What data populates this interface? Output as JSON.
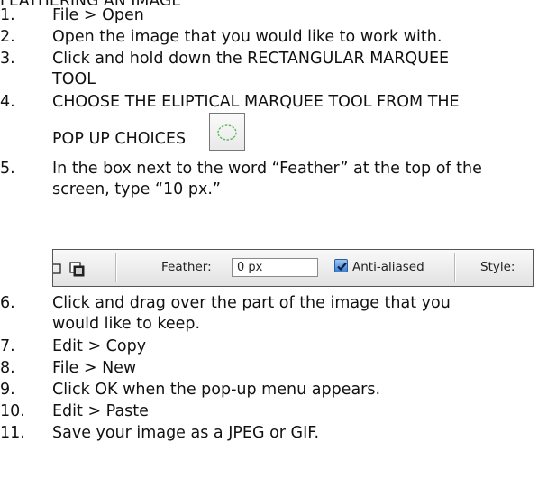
{
  "header": "FEATHERING AN IMAGE",
  "steps": [
    {
      "num": "1.",
      "lines": [
        "File > Open"
      ]
    },
    {
      "num": "2.",
      "lines": [
        "Open the image that you would like to work with."
      ]
    },
    {
      "num": "3.",
      "lines": [
        "Click and hold down the RECTANGULAR MARQUEE",
        "TOOL"
      ]
    },
    {
      "num": "4.",
      "lines": [
        "CHOOSE THE ELIPTICAL MARQUEE TOOL FROM THE",
        "POP UP CHOICES"
      ]
    },
    {
      "num": "5.",
      "lines": [
        "In the box next to the word “Feather” at the top of the",
        "screen, type “10 px.”"
      ]
    },
    {
      "num": "6.",
      "lines": [
        "Click and drag over the part of the image that you",
        "would like to keep."
      ]
    },
    {
      "num": "7.",
      "lines": [
        "Edit > Copy"
      ]
    },
    {
      "num": "8.",
      "lines": [
        "File > New"
      ]
    },
    {
      "num": "9.",
      "lines": [
        "Click OK when the pop-up menu appears."
      ]
    },
    {
      "num": "10.",
      "lines": [
        "Edit > Paste"
      ]
    },
    {
      "num": "11.",
      "lines": [
        "Save your image   as a JPEG or GIF."
      ]
    }
  ],
  "toolbar": {
    "feather_label": "Feather:",
    "feather_value": "0 px",
    "antialias_label": "Anti-aliased",
    "antialias_checked": true,
    "style_label": "Style:"
  },
  "icons": {
    "marquee_tool": "elliptical-marquee-icon",
    "selection_modes": "selection-mode-icons",
    "checkbox": "checkmark-icon"
  },
  "colors": {
    "checkbox_fill": "#3b7fd2",
    "ellipse_stroke": "#5cb85c"
  }
}
